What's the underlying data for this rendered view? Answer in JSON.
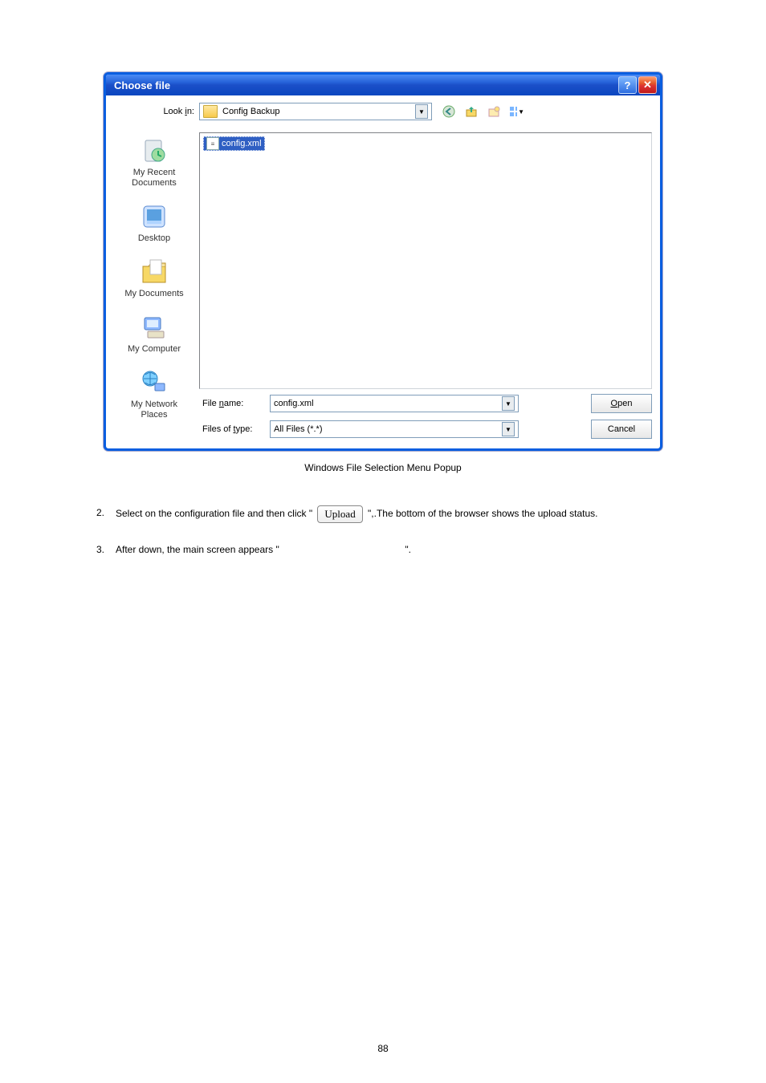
{
  "dialog": {
    "title": "Choose file",
    "lookin_label": "Look in:",
    "lookin_value": "Config Backup",
    "places": {
      "recent": "My Recent\nDocuments",
      "desktop": "Desktop",
      "mydocs": "My Documents",
      "mycomp": "My Computer",
      "network": "My Network\nPlaces"
    },
    "file_selected": "config.xml",
    "filename_label": "File name:",
    "filename_value": "config.xml",
    "filetype_label": "Files of type:",
    "filetype_value": "All Files (*.*)",
    "open_btn": "Open",
    "cancel_btn": "Cancel"
  },
  "caption": "Windows File Selection Menu Popup",
  "steps": {
    "s2_num": "2.",
    "s2_a": "Select on the configuration file and then click \"",
    "s2_upload": "Upload",
    "s2_b": "\",.The bottom of the browser shows the upload status.",
    "s3_num": "3.",
    "s3_a": "After down, the main screen appears \"",
    "s3_b": "\"."
  },
  "page_number": "88"
}
